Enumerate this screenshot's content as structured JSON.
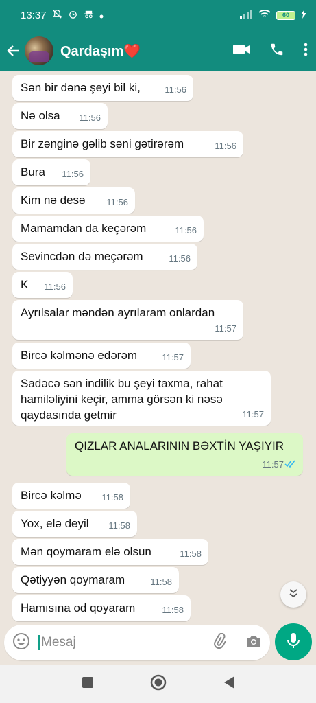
{
  "status_bar": {
    "time": "13:37",
    "battery": "60"
  },
  "header": {
    "contact_name": "Qardaşım❤️"
  },
  "messages": [
    {
      "text": "Sən bir dənə şeyi bil ki,",
      "time": "11:56"
    },
    {
      "text": "Nə olsa",
      "time": "11:56"
    },
    {
      "text": "Bir zənginə gəlib səni gətirərəm",
      "time": "11:56"
    },
    {
      "text": "Bura",
      "time": "11:56"
    },
    {
      "text": "Kim nə desə",
      "time": "11:56"
    },
    {
      "text": "Mamamdan da keçərəm",
      "time": "11:56"
    },
    {
      "text": "Sevincdən də meçərəm",
      "time": "11:56"
    },
    {
      "text": "K",
      "time": "11:56"
    },
    {
      "text": "Ayrılsalar məndən ayrılaram onlardan",
      "time": "11:57"
    },
    {
      "text": "Bircə kəlmənə edərəm",
      "time": "11:57"
    },
    {
      "text": "Sadəcə sən indilik bu şeyi taxma, rahat hamiləliyini keçir, amma görsən ki nəsə qaydasında getmir",
      "time": "11:57"
    },
    {
      "text": "QIZLAR ANALARININ BƏXTİN YAŞIYIR",
      "time": "11:57",
      "outgoing": true
    },
    {
      "text": "Bircə kəlmə",
      "time": "11:58"
    },
    {
      "text": "Yox, elə deyil",
      "time": "11:58"
    },
    {
      "text": "Mən qoymaram elə olsun",
      "time": "11:58"
    },
    {
      "text": "Qətiyyən qoymaram",
      "time": "11:58"
    },
    {
      "text": "Hamısına od qoyaram",
      "time": "11:58"
    }
  ],
  "composer": {
    "placeholder": "Mesaj"
  },
  "colors": {
    "header": "#128c7e",
    "outgoing_bubble": "#dcf8c6",
    "incoming_bubble": "#ffffff",
    "chat_background": "#ece5dd",
    "mic_button": "#00a884",
    "read_ticks": "#34b7f1"
  },
  "icons": [
    "arrow-back-icon",
    "video-call-icon",
    "phone-icon",
    "more-vert-icon",
    "emoji-icon",
    "attach-icon",
    "camera-icon",
    "mic-icon",
    "chevron-down-icon",
    "double-check-icon",
    "nav-recents-icon",
    "nav-home-icon",
    "nav-back-icon"
  ]
}
